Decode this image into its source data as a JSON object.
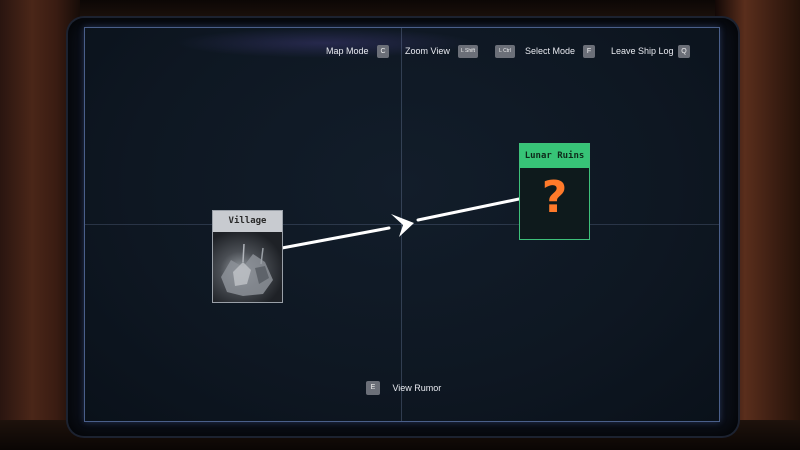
{
  "controls": [
    {
      "label": "Map Mode",
      "key": "C"
    },
    {
      "label": "Zoom View",
      "key": "L Shift",
      "key2": "L Ctrl"
    },
    {
      "label": "Select Mode",
      "key": "F"
    },
    {
      "label": "Leave Ship Log",
      "key": "Q"
    }
  ],
  "entries": {
    "village": {
      "title": "Village",
      "image": "village-photo"
    },
    "lunar_ruins": {
      "title": "Lunar Ruins",
      "icon": "question-mark",
      "symbol": "?"
    }
  },
  "connection": {
    "from": "Village",
    "to": "Lunar Ruins",
    "color": "#ffffff"
  },
  "footer": {
    "label": "View Rumor",
    "key": "E"
  },
  "colors": {
    "screen_border": "#4a5f8a",
    "unexplored_header": "#37c477",
    "question_mark": "#ff7a2a",
    "explored_header": "#c8cbd0"
  }
}
